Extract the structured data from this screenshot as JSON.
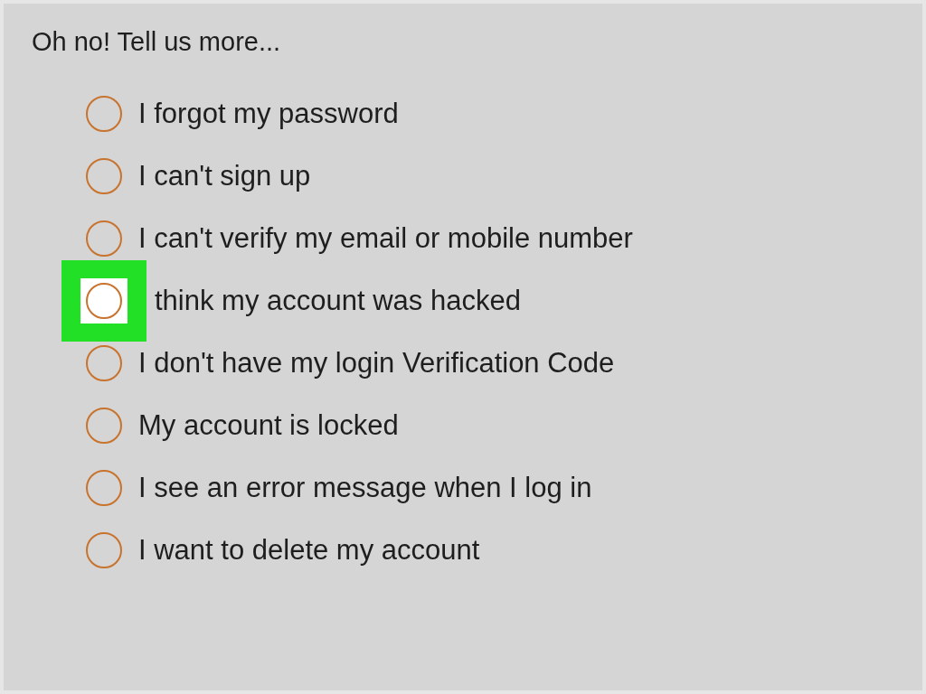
{
  "title": "Oh no! Tell us more...",
  "options": [
    {
      "label": "I forgot my password",
      "selected": false,
      "highlighted": false
    },
    {
      "label": "I can't sign up",
      "selected": false,
      "highlighted": false
    },
    {
      "label": "I can't verify my email or mobile number",
      "selected": false,
      "highlighted": false
    },
    {
      "label": "think my account was hacked",
      "selected": false,
      "highlighted": true
    },
    {
      "label": "I don't have my login Verification Code",
      "selected": false,
      "highlighted": false
    },
    {
      "label": "My account is locked",
      "selected": false,
      "highlighted": false
    },
    {
      "label": "I see an error message when I log in",
      "selected": false,
      "highlighted": false
    },
    {
      "label": "I want to delete my account",
      "selected": false,
      "highlighted": false
    }
  ]
}
